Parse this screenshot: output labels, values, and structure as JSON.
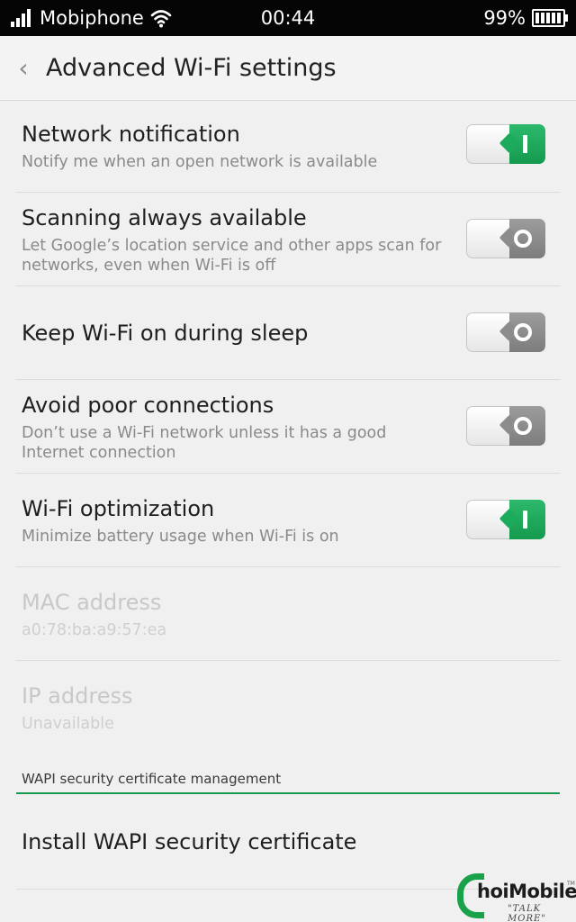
{
  "status_bar": {
    "carrier": "Mobiphone",
    "time": "00:44",
    "battery": "99%",
    "icons": [
      "signal-icon",
      "wifi-icon",
      "battery-icon"
    ]
  },
  "action_bar": {
    "back_icon": "chevron-left-icon",
    "back_glyph": "‹",
    "title": "Advanced Wi-Fi settings"
  },
  "settings": {
    "network_notification": {
      "label": "Network notification",
      "summary": "Notify me when an open network is available",
      "enabled": true
    },
    "scanning_always_available": {
      "label": "Scanning always available",
      "summary": "Let Google’s location service and other apps scan for networks, even when Wi-Fi is off",
      "enabled": false
    },
    "keep_wifi_on": {
      "label": "Keep Wi-Fi on during sleep",
      "enabled": false
    },
    "avoid_poor_connections": {
      "label": "Avoid poor connections",
      "summary": "Don’t use a Wi-Fi network unless it has a good Internet connection",
      "enabled": false
    },
    "wifi_optimization": {
      "label": "Wi-Fi optimization",
      "summary": "Minimize battery usage when Wi-Fi is on",
      "enabled": true
    },
    "mac_address": {
      "label": "MAC address",
      "value": "a0:78:ba:a9:57:ea"
    },
    "ip_address": {
      "label": "IP address",
      "value": "Unavailable"
    }
  },
  "wapi": {
    "category": "WAPI security certificate management",
    "install_label": "Install WAPI security certificate"
  },
  "watermark": {
    "brand": "hoiMobile",
    "tagline": "\"TALK MORE\"",
    "tm": "TM"
  },
  "colors": {
    "accent_green": "#1a9a50",
    "status_bar_bg": "#050505",
    "background": "#f0f0f0",
    "toggle_on": "#1cab5c",
    "toggle_off": "#8c8c8c"
  }
}
